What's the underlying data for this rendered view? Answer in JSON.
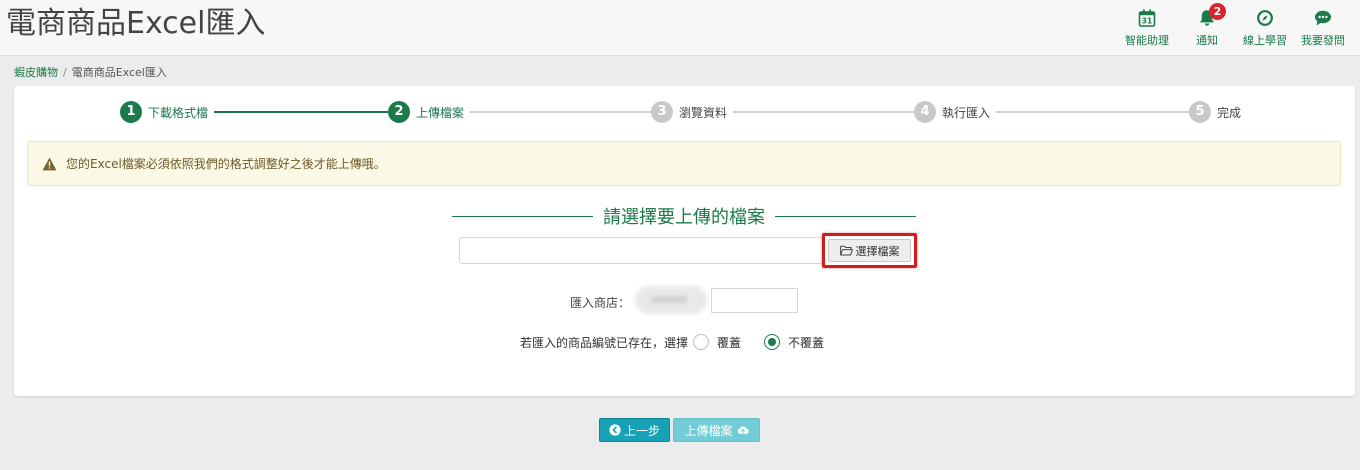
{
  "page_title": "電商商品Excel匯入",
  "top_actions": [
    {
      "label": "智能助理",
      "icon": "calendar-icon",
      "icon_text": "31"
    },
    {
      "label": "通知",
      "icon": "bell-icon",
      "badge": "2"
    },
    {
      "label": "線上學習",
      "icon": "compass-icon"
    },
    {
      "label": "我要發問",
      "icon": "chat-bubble-icon"
    }
  ],
  "breadcrumb": {
    "parent": "蝦皮購物",
    "separator": "/",
    "current": "電商商品Excel匯入"
  },
  "steps": [
    {
      "num": "1",
      "label": "下載格式檔",
      "active": true
    },
    {
      "num": "2",
      "label": "上傳檔案",
      "active": true
    },
    {
      "num": "3",
      "label": "瀏覽資料",
      "active": false
    },
    {
      "num": "4",
      "label": "執行匯入",
      "active": false
    },
    {
      "num": "5",
      "label": "完成",
      "active": false
    }
  ],
  "alert": {
    "icon": "warning-icon",
    "message": "您的Excel檔案必須依照我們的格式調整好之後才能上傳哦。"
  },
  "upload": {
    "section_title": "請選擇要上傳的檔案",
    "file_value": "",
    "choose_button": "選擇檔案",
    "choose_icon": "folder-open-icon"
  },
  "shop": {
    "label": "匯入商店：",
    "value": ""
  },
  "overwrite": {
    "prompt": "若匯入的商品編號已存在，選擇",
    "options": [
      {
        "label": "覆蓋",
        "checked": false
      },
      {
        "label": "不覆蓋",
        "checked": true
      }
    ]
  },
  "buttons": {
    "prev": "上一步",
    "prev_icon": "chevron-left-circle-icon",
    "upload": "上傳檔案",
    "upload_icon": "cloud-upload-icon"
  },
  "colors": {
    "brand": "#1b7a4a",
    "step_inactive": "#c8c8c8",
    "badge": "#d9242f",
    "alert_bg": "#fcf8e6",
    "highlight": "#d01d1d",
    "btn_prev": "#17a2b8",
    "btn_upload": "#71ccd6"
  }
}
